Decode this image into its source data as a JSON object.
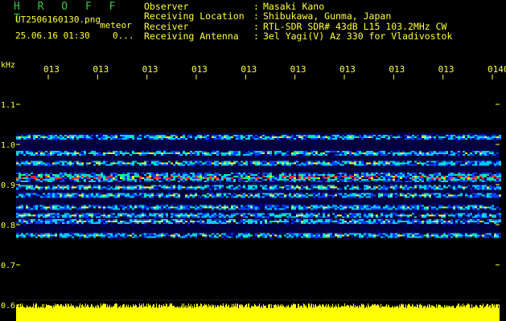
{
  "header": {
    "app_name": "H R O F F T",
    "file_name": "UT2506160130.png",
    "mode_label": "meteor",
    "datetime": "25.06.16 01:30",
    "count": "0..."
  },
  "station_info": [
    {
      "label": "Observer",
      "sep": ":",
      "value": "Masaki Kano"
    },
    {
      "label": "Receiving Location",
      "sep": ":",
      "value": "Shibukawa, Gunma, Japan"
    },
    {
      "label": "Receiver",
      "sep": ":",
      "value": "RTL-SDR SDR# 43dB L15 103.2MHz CW"
    },
    {
      "label": "Receiving Antenna",
      "sep": ":",
      "value": "3el Yagi(V) Az 330 for Vladivostok"
    }
  ],
  "chart_data": {
    "type": "heatmap",
    "ylabel": "kHz",
    "y_ticks": [
      "1.1",
      "1.0",
      "0.9",
      "0.8",
      "0.7",
      "0.6"
    ],
    "ylim": [
      0.6,
      1.1
    ],
    "x_ticks": [
      "013",
      "013",
      "013",
      "013",
      "013",
      "013",
      "013",
      "013",
      "013",
      "0140"
    ],
    "signal_bands_khz": [
      1.02,
      0.98,
      0.955,
      0.92,
      0.895,
      0.875,
      0.845,
      0.825,
      0.81,
      0.775
    ],
    "strongest_band_khz": 0.92,
    "colors": {
      "background": "#000000",
      "labels": "#ffff33",
      "noise_low": "#0000a0",
      "noise_mid": "#00c8ff",
      "noise_high": "#ffff00",
      "peak": "#ff3030",
      "amplitude_bar": "#ffff00"
    }
  }
}
